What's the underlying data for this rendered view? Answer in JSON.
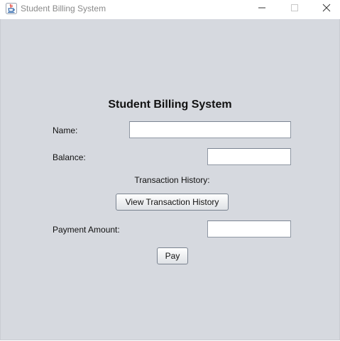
{
  "window": {
    "title": "Student Billing System",
    "controls": {
      "minimize_icon": "minimize-icon",
      "maximize_icon": "maximize-icon",
      "close_icon": "close-icon"
    },
    "app_icon": "java-cup-icon"
  },
  "form": {
    "title": "Student Billing System",
    "name_label": "Name:",
    "name_value": "",
    "balance_label": "Balance:",
    "balance_value": "",
    "transaction_history_label": "Transaction History:",
    "view_history_button": "View Transaction History",
    "payment_amount_label": "Payment Amount:",
    "payment_amount_value": "",
    "pay_button": "Pay"
  },
  "colors": {
    "content_background": "#d6d9df",
    "titlebar_background": "#ffffff",
    "title_text": "#8a8a8a",
    "java_icon_red": "#e0362c",
    "java_icon_blue": "#3a6fb0"
  }
}
